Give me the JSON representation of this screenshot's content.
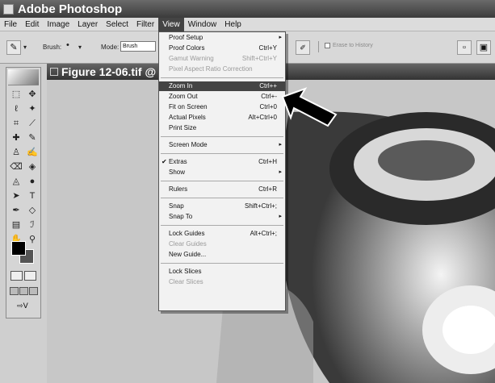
{
  "app": {
    "title": "Adobe Photoshop"
  },
  "menubar": {
    "items": [
      "File",
      "Edit",
      "Image",
      "Layer",
      "Select",
      "Filter",
      "View",
      "Window",
      "Help"
    ],
    "active": "View"
  },
  "options": {
    "brush_label": "Brush:",
    "mode_label": "Mode:",
    "mode_value": "Brush",
    "erase_history": "Erase to History"
  },
  "document": {
    "title": "Figure 12-06.tif @"
  },
  "view_menu": {
    "items": [
      {
        "label": "Proof Setup",
        "shortcut": "",
        "submenu": true,
        "disabled": false
      },
      {
        "label": "Proof Colors",
        "shortcut": "Ctrl+Y",
        "submenu": false,
        "disabled": false
      },
      {
        "label": "Gamut Warning",
        "shortcut": "Shift+Ctrl+Y",
        "submenu": false,
        "disabled": true
      },
      {
        "label": "Pixel Aspect Ratio Correction",
        "shortcut": "",
        "submenu": false,
        "disabled": true
      },
      {
        "label": "Zoom In",
        "shortcut": "Ctrl++",
        "submenu": false,
        "disabled": false,
        "highlight": true
      },
      {
        "label": "Zoom Out",
        "shortcut": "Ctrl+-",
        "submenu": false,
        "disabled": false
      },
      {
        "label": "Fit on Screen",
        "shortcut": "Ctrl+0",
        "submenu": false,
        "disabled": false
      },
      {
        "label": "Actual Pixels",
        "shortcut": "Alt+Ctrl+0",
        "submenu": false,
        "disabled": false
      },
      {
        "label": "Print Size",
        "shortcut": "",
        "submenu": false,
        "disabled": false
      },
      {
        "label": "Screen Mode",
        "shortcut": "",
        "submenu": true,
        "disabled": false
      },
      {
        "label": "Extras",
        "shortcut": "Ctrl+H",
        "submenu": false,
        "disabled": false,
        "checked": true
      },
      {
        "label": "Show",
        "shortcut": "",
        "submenu": true,
        "disabled": false
      },
      {
        "label": "Rulers",
        "shortcut": "Ctrl+R",
        "submenu": false,
        "disabled": false
      },
      {
        "label": "Snap",
        "shortcut": "Shift+Ctrl+;",
        "submenu": false,
        "disabled": false
      },
      {
        "label": "Snap To",
        "shortcut": "",
        "submenu": true,
        "disabled": false
      },
      {
        "label": "Lock Guides",
        "shortcut": "Alt+Ctrl+;",
        "submenu": false,
        "disabled": false
      },
      {
        "label": "Clear Guides",
        "shortcut": "",
        "submenu": false,
        "disabled": true
      },
      {
        "label": "New Guide...",
        "shortcut": "",
        "submenu": false,
        "disabled": false
      },
      {
        "label": "Lock Slices",
        "shortcut": "",
        "submenu": false,
        "disabled": false
      },
      {
        "label": "Clear Slices",
        "shortcut": "",
        "submenu": false,
        "disabled": true
      }
    ]
  }
}
